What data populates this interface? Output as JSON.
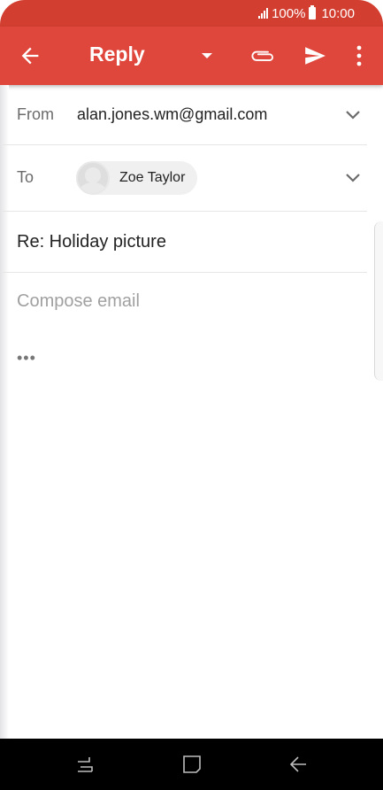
{
  "status_bar": {
    "battery": "100%",
    "time": "10:00"
  },
  "app_bar": {
    "title": "Reply",
    "colors": {
      "background": "#e0473c",
      "status": "#d23f31"
    }
  },
  "fields": {
    "from_label": "From",
    "from_value": "alan.jones.wm@gmail.com",
    "to_label": "To",
    "to_recipient": "Zoe Taylor",
    "subject": "Re: Holiday picture"
  },
  "compose": {
    "placeholder": "Compose email",
    "quoted_toggle": "•••"
  },
  "icons": {
    "back": "arrow-back-icon",
    "dropdown": "caret-down-icon",
    "attach": "paperclip-icon",
    "send": "send-icon",
    "more": "more-vert-icon"
  }
}
